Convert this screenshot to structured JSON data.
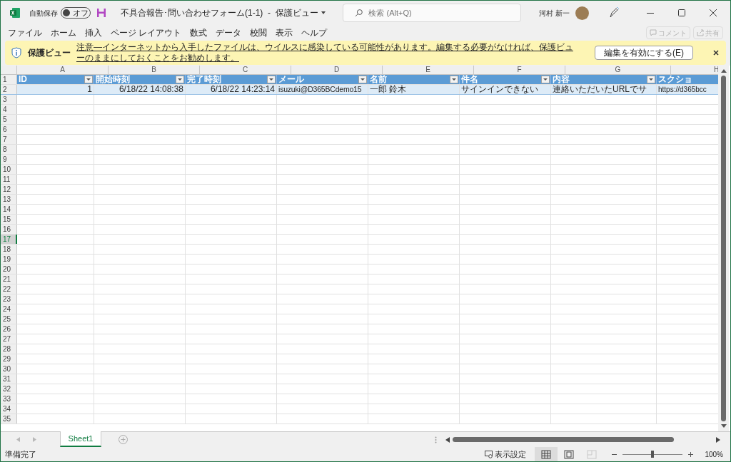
{
  "titlebar": {
    "autosave_label": "自動保存",
    "autosave": {
      "label": "オフ",
      "on": false
    },
    "title": "不具合報告･問い合わせフォーム(1-1)  -  保護ビュー",
    "search": {
      "placeholder": "検索 (Alt+Q)"
    },
    "user": "河村 新一"
  },
  "menu": {
    "items": [
      "ファイル",
      "ホーム",
      "挿入",
      "ページ レイアウト",
      "数式",
      "データ",
      "校閲",
      "表示",
      "ヘルプ"
    ],
    "actions": [
      {
        "label": "コメント",
        "disabled": true
      },
      {
        "label": "共有",
        "disabled": true
      }
    ]
  },
  "infobar": {
    "title": "保護ビュー",
    "message": "注意―インターネットから入手したファイルは、ウイルスに感染している可能性があります。編集する必要がなければ、保護ビューのままにしておくことをお勧めします。",
    "button": "編集を有効にする(E)"
  },
  "sheet": {
    "columns": [
      "A",
      "B",
      "C",
      "D",
      "E",
      "F",
      "G",
      "H"
    ],
    "header_row": [
      "ID",
      "開始時刻",
      "完了時刻",
      "メール",
      "名前",
      "件名",
      "内容",
      "スクショ"
    ],
    "data_row": [
      {
        "text": "1",
        "kind": "number"
      },
      {
        "text": "6/18/22 14:08:38",
        "kind": "number"
      },
      {
        "text": "6/18/22 14:23:14",
        "kind": "number"
      },
      {
        "text": "isuzuki@D365BCdemo15",
        "kind": "text"
      },
      {
        "text": "一郎 鈴木",
        "kind": "text"
      },
      {
        "text": "サインインできない",
        "kind": "text"
      },
      {
        "text": "連絡いただいたURLでサ",
        "kind": "text"
      },
      {
        "text": "https://d365bcc",
        "kind": "text"
      }
    ],
    "row_headers": [
      {
        "label": "1",
        "selected": false
      },
      {
        "label": "2",
        "selected": false
      },
      {
        "label": "3",
        "selected": false
      },
      {
        "label": "4",
        "selected": false
      },
      {
        "label": "5",
        "selected": false
      },
      {
        "label": "6",
        "selected": false
      },
      {
        "label": "7",
        "selected": false
      },
      {
        "label": "8",
        "selected": false
      },
      {
        "label": "9",
        "selected": false
      },
      {
        "label": "10",
        "selected": false
      },
      {
        "label": "11",
        "selected": false
      },
      {
        "label": "12",
        "selected": false
      },
      {
        "label": "13",
        "selected": false
      },
      {
        "label": "14",
        "selected": false
      },
      {
        "label": "15",
        "selected": false
      },
      {
        "label": "16",
        "selected": false
      },
      {
        "label": "17",
        "selected": true
      },
      {
        "label": "18",
        "selected": false
      },
      {
        "label": "19",
        "selected": false
      },
      {
        "label": "20",
        "selected": false
      },
      {
        "label": "21",
        "selected": false
      },
      {
        "label": "22",
        "selected": false
      },
      {
        "label": "23",
        "selected": false
      },
      {
        "label": "24",
        "selected": false
      },
      {
        "label": "25",
        "selected": false
      },
      {
        "label": "26",
        "selected": false
      },
      {
        "label": "27",
        "selected": false
      },
      {
        "label": "28",
        "selected": false
      },
      {
        "label": "29",
        "selected": false
      },
      {
        "label": "30",
        "selected": false
      },
      {
        "label": "31",
        "selected": false
      },
      {
        "label": "32",
        "selected": false
      },
      {
        "label": "33",
        "selected": false
      },
      {
        "label": "34",
        "selected": false
      },
      {
        "label": "35",
        "selected": false
      }
    ]
  },
  "sheet_tabs": [
    {
      "label": "Sheet1",
      "selected": true
    }
  ],
  "status_bar": {
    "status": "準備完了",
    "display_settings": "表示設定",
    "views": [
      {
        "kind": "normal",
        "selected": true,
        "disabled": false
      },
      {
        "kind": "page_layout",
        "selected": false,
        "disabled": false
      },
      {
        "kind": "page_break",
        "selected": false,
        "disabled": true
      }
    ],
    "zoom": {
      "level": 0.5,
      "reading": "100%"
    }
  }
}
